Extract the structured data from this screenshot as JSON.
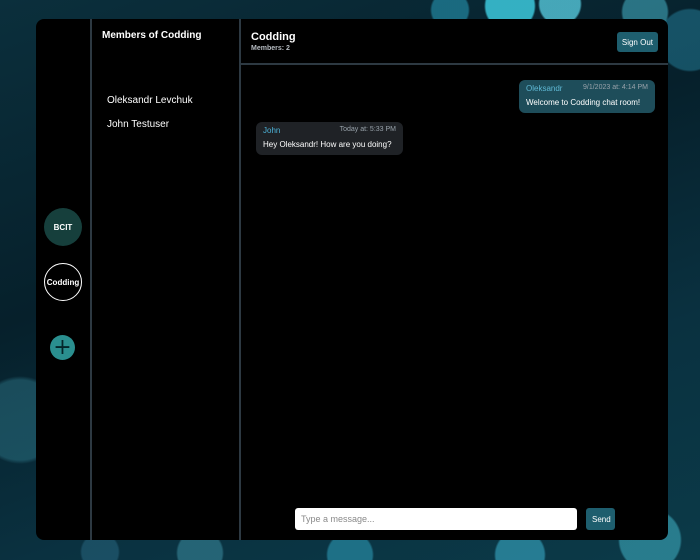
{
  "servers": [
    {
      "label": "BCIT"
    },
    {
      "label": "Codding"
    }
  ],
  "add_server_symbol": "+",
  "members_panel": {
    "title": "Members of Codding",
    "members": [
      "Oleksandr Levchuk",
      "John Testuser"
    ]
  },
  "chat": {
    "title": "Codding",
    "members_count": "Members: 2",
    "sign_out_label": "Sign Out",
    "messages": [
      {
        "author": "Oleksandr",
        "time": "9/1/2023 at: 4:14 PM",
        "text": "Welcome to Codding chat room!",
        "direction": "sent"
      },
      {
        "author": "John",
        "time": "Today at: 5:33 PM",
        "text": "Hey Oleksandr! How are you doing?",
        "direction": "received"
      }
    ],
    "input_placeholder": "Type a message...",
    "input_value": "",
    "send_label": "Send"
  },
  "colors": {
    "accent": "#1e5e6e",
    "sent_bubble": "#1e4d5a",
    "received_bubble": "#1f2226",
    "author_name": "#4cb3d8"
  }
}
